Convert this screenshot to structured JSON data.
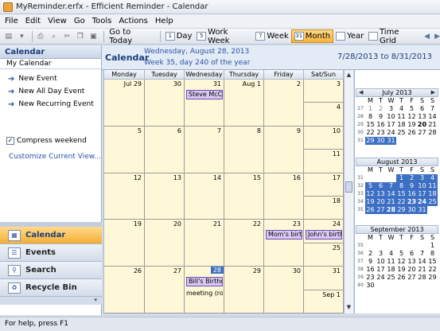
{
  "window": {
    "title": "MyReminder.erfx - Efficient Reminder - Calendar"
  },
  "menu": [
    "File",
    "Edit",
    "View",
    "Go",
    "Tools",
    "Actions",
    "Help"
  ],
  "toolbar": {
    "go_to_today": "Go to Today",
    "day": "Day",
    "work_week": "Work Week",
    "week": "Week",
    "month": "Month",
    "year": "Year",
    "time_grid": "Time Grid",
    "day_glyph": "1",
    "work_week_glyph": "5",
    "week_glyph": "7",
    "month_glyph": "31"
  },
  "left_panel": {
    "header": "Calendar",
    "subheader": "My Calendar",
    "actions": [
      "New Event",
      "New All Day Event",
      "New Recurring Event"
    ],
    "compress_weekend": "Compress weekend",
    "compress_checked": true,
    "customize_link": "Customize Current View..."
  },
  "nav": [
    {
      "label": "Calendar",
      "icon": "calendar-icon",
      "active": true
    },
    {
      "label": "Events",
      "icon": "events-icon",
      "active": false
    },
    {
      "label": "Search",
      "icon": "search-icon",
      "active": false
    },
    {
      "label": "Recycle Bin",
      "icon": "recycle-bin-icon",
      "active": false
    }
  ],
  "calendar": {
    "title": "Calendar",
    "current_date": "Wednesday, August 28, 2013",
    "week_info": "Week 35, day 240 of the year",
    "range": "7/28/2013 to 8/31/2013",
    "day_headers": [
      "Monday",
      "Tuesday",
      "Wednesday",
      "Thursday",
      "Friday",
      "Sat/Sun"
    ],
    "weeks": [
      {
        "days": [
          "Jul 29",
          "30",
          "31",
          "Aug 1",
          "2"
        ],
        "sat": "3",
        "sun": "4"
      },
      {
        "days": [
          "5",
          "6",
          "7",
          "8",
          "9"
        ],
        "sat": "10",
        "sun": "11"
      },
      {
        "days": [
          "12",
          "13",
          "14",
          "15",
          "16"
        ],
        "sat": "17",
        "sun": "18"
      },
      {
        "days": [
          "19",
          "20",
          "21",
          "22",
          "23"
        ],
        "sat": "24",
        "sun": "25"
      },
      {
        "days": [
          "26",
          "27",
          "28",
          "29",
          "30"
        ],
        "sat": "31",
        "sun": "Sep 1"
      }
    ],
    "events": [
      {
        "week": 0,
        "day": 2,
        "label": "Steve McCor"
      },
      {
        "week": 3,
        "day": 4,
        "label": "Mom's birthd"
      },
      {
        "week": 3,
        "day": 5,
        "label": "John's birthd"
      },
      {
        "week": 4,
        "day": 2,
        "label": "Bill's Birthday"
      }
    ],
    "notes": [
      {
        "week": 4,
        "day": 2,
        "label": "meeting (roor"
      }
    ],
    "today": {
      "week": 4,
      "day": 2
    }
  },
  "mini_calendars": [
    {
      "title": "July 2013",
      "dow": [
        "M",
        "T",
        "W",
        "T",
        "F",
        "S",
        "S"
      ],
      "weeks": [
        {
          "wn": "27",
          "d": [
            [
              "1",
              "n"
            ],
            [
              "2",
              "n"
            ],
            [
              "3",
              "n"
            ],
            [
              "4",
              "n"
            ],
            [
              "5",
              "n"
            ],
            [
              "6",
              "n"
            ],
            [
              "7",
              "n"
            ]
          ],
          "prefix": [
            [
              "29",
              "g"
            ],
            [
              "30",
              "g"
            ]
          ]
        },
        {
          "wn": "28",
          "d": [
            [
              "8",
              "n"
            ],
            [
              "9",
              "n"
            ],
            [
              "10",
              "n"
            ],
            [
              "11",
              "n"
            ],
            [
              "12",
              "n"
            ],
            [
              "13",
              "n"
            ],
            [
              "14",
              "n"
            ]
          ]
        }
      ]
    }
  ],
  "mini": {
    "july": {
      "title": "July 2013",
      "rows": [
        [
          "27",
          "g:1",
          "g:2",
          "3",
          "4",
          "5",
          "6",
          "7"
        ],
        [
          "28",
          "8",
          "9",
          "10",
          "11",
          "12",
          "13",
          "14"
        ],
        [
          "29",
          "15",
          "16",
          "17",
          "18",
          "19",
          "20",
          "21"
        ],
        [
          "30",
          "22",
          "23",
          "24",
          "25",
          "26",
          "27",
          "28"
        ],
        [
          "31",
          "s:29",
          "s:30",
          "s:31",
          "",
          "",
          "",
          ""
        ]
      ]
    },
    "august": {
      "title": "August 2013",
      "rows": [
        [
          "31",
          "",
          "",
          "",
          "s:1",
          "s:2",
          "s:3",
          "s:4"
        ],
        [
          "32",
          "s:5",
          "s:6",
          "s:7",
          "s:8",
          "s:9",
          "s:10",
          "s:11"
        ],
        [
          "33",
          "s:12",
          "s:13",
          "s:14",
          "s:15",
          "s:16",
          "s:17",
          "s:18"
        ],
        [
          "34",
          "s:19",
          "s:20",
          "s:21",
          "s:22",
          "s:23",
          "s:24",
          "s:25"
        ],
        [
          "35",
          "s:26",
          "s:27",
          "s:28",
          "s:29",
          "s:30",
          "s:31",
          ""
        ]
      ]
    },
    "september": {
      "title": "September 2013",
      "rows": [
        [
          "35",
          "",
          "",
          "",
          "",
          "",
          "",
          "1"
        ],
        [
          "36",
          "2",
          "3",
          "4",
          "5",
          "6",
          "7",
          "8"
        ],
        [
          "37",
          "9",
          "10",
          "11",
          "12",
          "13",
          "14",
          "15"
        ],
        [
          "38",
          "16",
          "17",
          "18",
          "19",
          "20",
          "21",
          "22"
        ],
        [
          "39",
          "23",
          "24",
          "25",
          "26",
          "27",
          "28",
          "29"
        ],
        [
          "40",
          "30",
          "",
          "",
          "",
          "",
          "",
          ""
        ]
      ]
    }
  },
  "status": "For help, press F1"
}
